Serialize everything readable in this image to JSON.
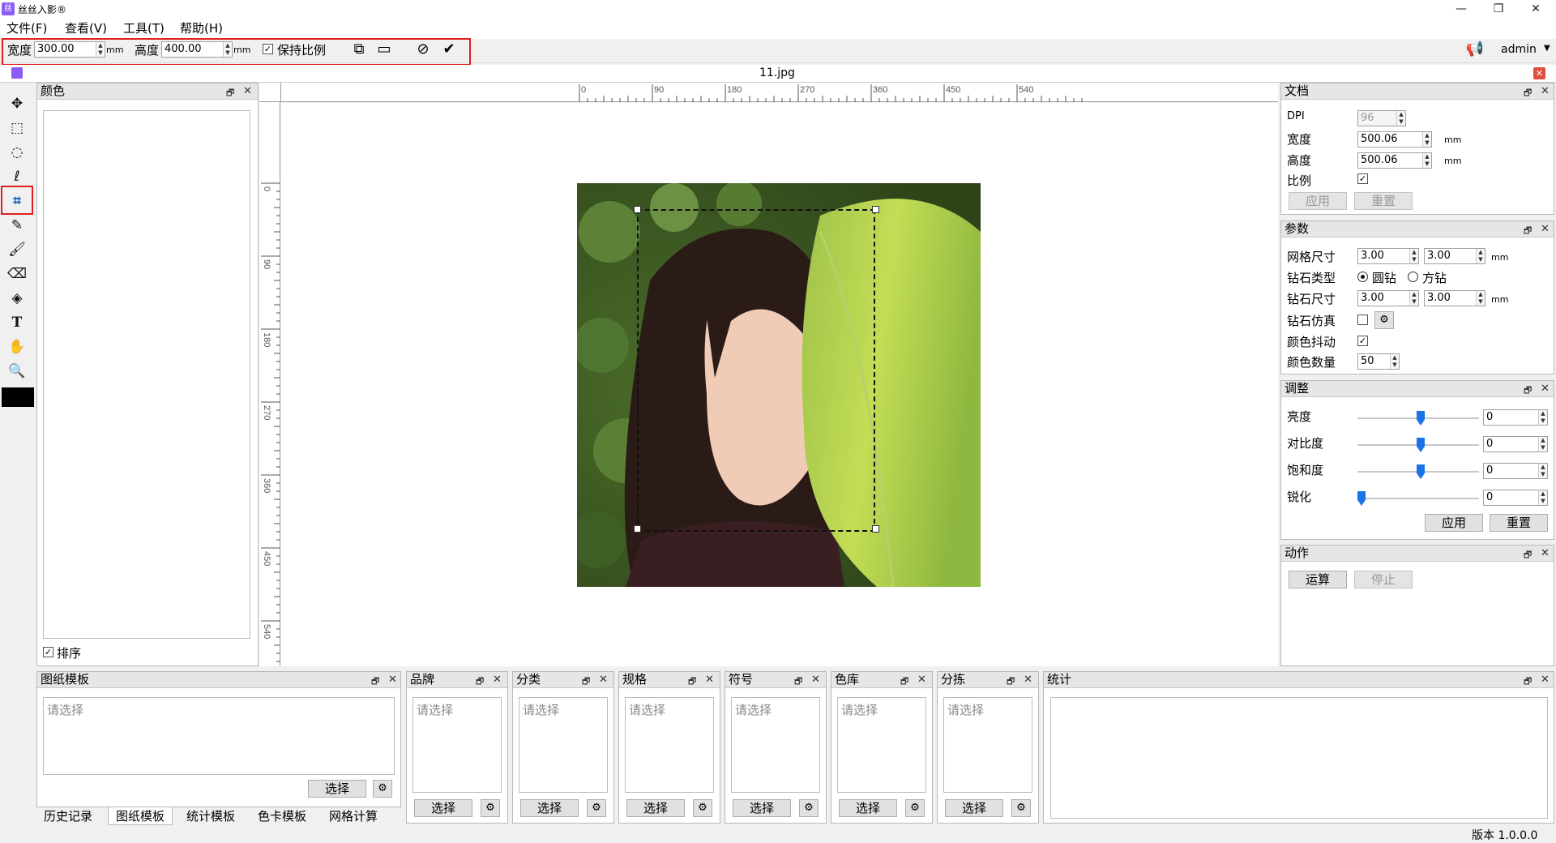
{
  "window": {
    "title": "丝丝入影®",
    "minimize_glyph": "—",
    "restore_glyph": "❐",
    "close_glyph": "✕"
  },
  "menu": [
    {
      "label": "文件(F)"
    },
    {
      "label": "查看(V)"
    },
    {
      "label": "工具(T)"
    },
    {
      "label": "帮助(H)"
    }
  ],
  "toolbar": {
    "width_label": "宽度",
    "width_value": "300.00",
    "width_unit": "mm",
    "height_label": "高度",
    "height_value": "400.00",
    "height_unit": "mm",
    "keep_ratio_label": "保持比例",
    "keep_ratio_checked": true,
    "user": "admin"
  },
  "document": {
    "tab_title": "11.jpg"
  },
  "ruler": {
    "h_ticks": [
      "0",
      "90",
      "180",
      "270",
      "360",
      "450",
      "540"
    ],
    "v_ticks": [
      "0",
      "90",
      "180",
      "270",
      "360",
      "450",
      "540"
    ]
  },
  "color_panel": {
    "title": "颜色",
    "sort_label": "排序",
    "sort_checked": true
  },
  "doc_panel": {
    "title": "文档",
    "dpi_label": "DPI",
    "dpi_value": "96",
    "width_label": "宽度",
    "width_value": "500.06",
    "height_label": "高度",
    "height_value": "500.06",
    "unit": "mm",
    "ratio_label": "比例",
    "apply": "应用",
    "reset": "重置"
  },
  "param_panel": {
    "title": "参数",
    "grid_label": "网格尺寸",
    "grid_w": "3.00",
    "grid_h": "3.00",
    "diamond_type_label": "钻石类型",
    "round": "圆钻",
    "square": "方钻",
    "diamond_size_label": "钻石尺寸",
    "size_w": "3.00",
    "size_h": "3.00",
    "simulate_label": "钻石仿真",
    "dither_label": "颜色抖动",
    "count_label": "颜色数量",
    "count_value": "50",
    "unit": "mm"
  },
  "adjust_panel": {
    "title": "调整",
    "rows": [
      {
        "label": "亮度",
        "value": "0",
        "level": 0.5
      },
      {
        "label": "对比度",
        "value": "0",
        "level": 0.5
      },
      {
        "label": "饱和度",
        "value": "0",
        "level": 0.5
      },
      {
        "label": "锐化",
        "value": "0",
        "level": 0.0
      }
    ],
    "apply": "应用",
    "reset": "重置"
  },
  "action_panel": {
    "title": "动作",
    "run": "运算",
    "stop": "停止"
  },
  "bottom": {
    "template_panel": {
      "title": "图纸模板",
      "placeholder": "请选择",
      "select": "选择"
    },
    "small_panels": [
      {
        "title": "品牌",
        "placeholder": "请选择",
        "select": "选择"
      },
      {
        "title": "分类",
        "placeholder": "请选择",
        "select": "选择"
      },
      {
        "title": "规格",
        "placeholder": "请选择",
        "select": "选择"
      },
      {
        "title": "符号",
        "placeholder": "请选择",
        "select": "选择"
      },
      {
        "title": "色库",
        "placeholder": "请选择",
        "select": "选择"
      },
      {
        "title": "分拣",
        "placeholder": "请选择",
        "select": "选择"
      }
    ],
    "stats_panel": {
      "title": "统计"
    },
    "tabs": [
      "历史记录",
      "图纸模板",
      "统计模板",
      "色卡模板",
      "网格计算"
    ]
  },
  "status": {
    "version": "版本 1.0.0.0"
  },
  "colors": {
    "highlight": "#e02020",
    "slider_thumb": "#1a73e8",
    "swatch": "#000000"
  },
  "icons": {
    "tools": [
      "move-icon",
      "rect-select-icon",
      "ellipse-select-icon",
      "lasso-icon",
      "crop-icon",
      "eyedropper-icon",
      "brush-icon",
      "eraser-icon",
      "fill-icon",
      "text-icon",
      "hand-icon",
      "zoom-icon"
    ]
  }
}
